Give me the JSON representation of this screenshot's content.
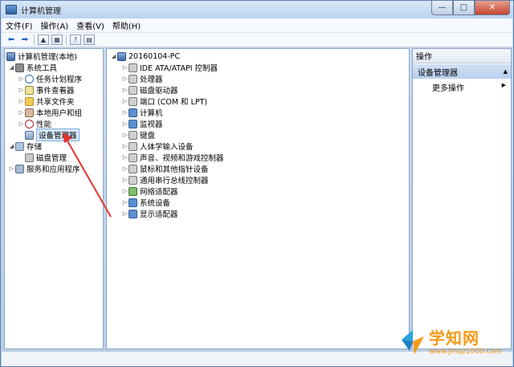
{
  "window": {
    "title": "计算机管理",
    "minimize": "—",
    "maximize": "□",
    "close": "✕"
  },
  "menu": [
    "文件(F)",
    "操作(A)",
    "查看(V)",
    "帮助(H)"
  ],
  "toolbar": {
    "back": "⬅",
    "forward": "➡",
    "icons": [
      "up-folder-icon",
      "show-hide-tree-icon",
      "help-icon",
      "properties-icon"
    ]
  },
  "left_tree": {
    "root": "计算机管理(本地)",
    "system_tools": "系统工具",
    "task_scheduler": "任务计划程序",
    "event_viewer": "事件查看器",
    "shared_folders": "共享文件夹",
    "local_users": "本地用户和组",
    "performance": "性能",
    "device_manager": "设备管理器",
    "storage": "存储",
    "disk_management": "磁盘管理",
    "services_apps": "服务和应用程序"
  },
  "device_tree": {
    "computer_name": "20160104-PC",
    "categories": [
      "IDE ATA/ATAPI 控制器",
      "处理器",
      "磁盘驱动器",
      "端口 (COM 和 LPT)",
      "计算机",
      "监视器",
      "键盘",
      "人体学输入设备",
      "声音、视频和游戏控制器",
      "鼠标和其他指针设备",
      "通用串行总线控制器",
      "网络适配器",
      "系统设备",
      "显示适配器"
    ]
  },
  "actions": {
    "header": "操作",
    "section": "设备管理器",
    "more": "更多操作"
  },
  "watermark": {
    "text": "学知网",
    "url": "www.jmqz1000.com"
  }
}
